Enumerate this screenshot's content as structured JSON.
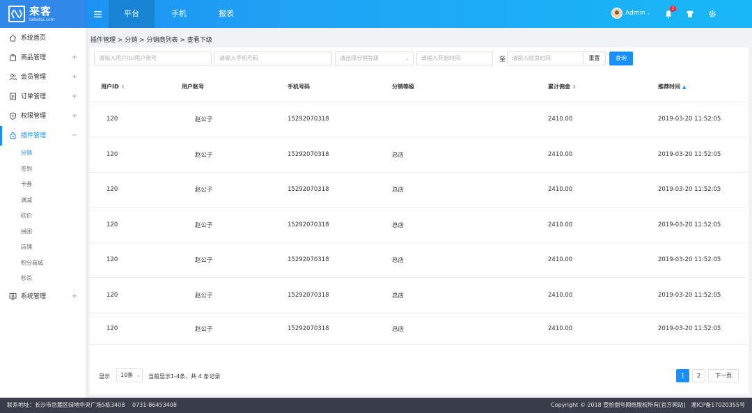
{
  "brand": {
    "name": "来客",
    "sub": "laiketui.com"
  },
  "topnav": {
    "tabs": [
      "平台",
      "手机",
      "报表"
    ],
    "user": "Admin",
    "notification_count": "2"
  },
  "sidebar": {
    "items": [
      {
        "label": "系统首页",
        "icon": "home-icon",
        "expand": ""
      },
      {
        "label": "商品管理",
        "icon": "bag-icon",
        "expand": "+"
      },
      {
        "label": "会员管理",
        "icon": "users-icon",
        "expand": "+"
      },
      {
        "label": "订单管理",
        "icon": "order-icon",
        "expand": "+"
      },
      {
        "label": "权限管理",
        "icon": "shield-icon",
        "expand": "+"
      },
      {
        "label": "插件管理",
        "icon": "plugin-icon",
        "expand": "−"
      }
    ],
    "subitems": [
      "分销",
      "签到",
      "卡券",
      "满减",
      "砍价",
      "拼团",
      "店铺",
      "积分商城",
      "秒杀"
    ],
    "last_item": {
      "label": "系统管理",
      "icon": "settings-icon",
      "expand": "+"
    }
  },
  "breadcrumb": "插件管理 > 分销 > 分销商列表 > 查看下级",
  "filters": {
    "user_placeholder": "请输入用户ID/用户账号",
    "phone_placeholder": "请输入手机号码",
    "level_placeholder": "请选择分销等级",
    "start_placeholder": "请输入开始时间",
    "to": "至",
    "end_placeholder": "请输入结束时间",
    "reset": "重置",
    "query": "查询"
  },
  "table": {
    "headers": [
      "用户ID",
      "用户账号",
      "手机号码",
      "分销等级",
      "累计佣金",
      "推荐时间"
    ],
    "rows": [
      [
        "120",
        "赵公子",
        "15292070318",
        "",
        "2410.00",
        "2019-03-20 11:52:05"
      ],
      [
        "120",
        "赵公子",
        "15292070318",
        "总店",
        "2410.00",
        "2019-03-20 11:52:05"
      ],
      [
        "120",
        "赵公子",
        "15292070318",
        "总店",
        "2410.00",
        "2019-03-20 11:52:05"
      ],
      [
        "120",
        "赵公子",
        "15292070318",
        "总店",
        "2410.00",
        "2019-03-20 11:52:05"
      ],
      [
        "120",
        "赵公子",
        "15292070318",
        "总店",
        "2410.00",
        "2019-03-20 11:52:05"
      ],
      [
        "120",
        "赵公子",
        "15292070318",
        "总店",
        "2410.00",
        "2019-03-20 11:52:05"
      ],
      [
        "120",
        "赵公子",
        "15292070318",
        "总店",
        "2410.00",
        "2019-03-20 11:52:05"
      ]
    ]
  },
  "pagination": {
    "show": "显示",
    "page_size": "10条",
    "info": "当前显示1-4条，共 4 条记录",
    "pages": [
      "1",
      "2"
    ],
    "next": "下一页"
  },
  "footer": {
    "left": "联系地址：长沙市岳麓区绿地中央广场5栋3408　 0731-86453408",
    "right": "Copyright © 2018 壹拾捌号网络版权所有[官方网站]　湘ICP备17020355号"
  },
  "colors": {
    "accent": "#1890ff",
    "topbar": "#1fa3f5",
    "footer": "#393d49"
  }
}
